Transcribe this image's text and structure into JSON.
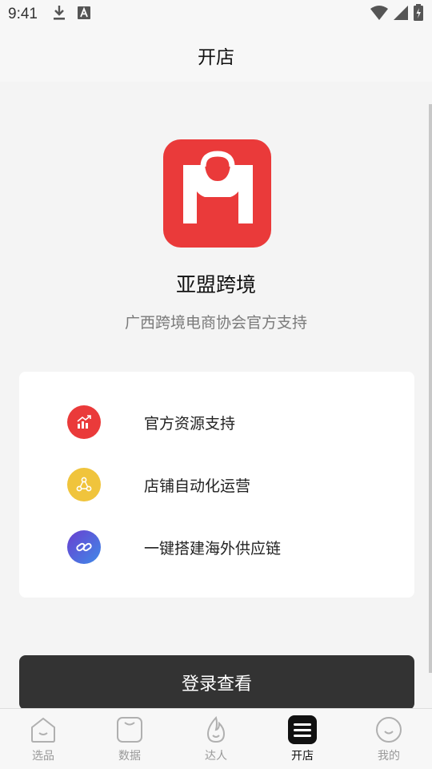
{
  "status_bar": {
    "time": "9:41"
  },
  "header": {
    "title": "开店"
  },
  "brand": {
    "name": "亚盟跨境",
    "subtitle": "广西跨境电商协会官方支持"
  },
  "features": [
    {
      "label": "官方资源支持",
      "icon": "growth-chart-icon",
      "color": "#ea3a3a"
    },
    {
      "label": "店铺自动化运营",
      "icon": "automation-icon",
      "color": "#f0c43c"
    },
    {
      "label": "一键搭建海外供应链",
      "icon": "link-icon",
      "color": "#5a5fd6"
    }
  ],
  "login_button": {
    "label": "登录查看"
  },
  "bottom_nav": {
    "active": "开店",
    "items": [
      {
        "label": "选品",
        "icon": "home-icon"
      },
      {
        "label": "数据",
        "icon": "bag-icon"
      },
      {
        "label": "达人",
        "icon": "flame-icon"
      },
      {
        "label": "开店",
        "icon": "menu-icon"
      },
      {
        "label": "我的",
        "icon": "smile-icon"
      }
    ]
  }
}
